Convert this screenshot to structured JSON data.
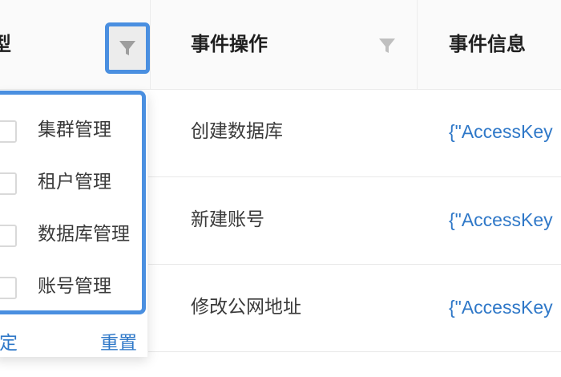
{
  "table": {
    "headers": {
      "type_partial": "型",
      "operation": "事件操作",
      "info": "事件信息"
    },
    "rows": [
      {
        "operation": "创建数据库",
        "info": "{\"AccessKey"
      },
      {
        "operation": "新建账号",
        "info": "{\"AccessKey"
      },
      {
        "operation": "修改公网地址",
        "info": "{\"AccessKey"
      }
    ]
  },
  "filter_dropdown": {
    "options": [
      {
        "label": "集群管理",
        "checked": false
      },
      {
        "label": "租户管理",
        "checked": false
      },
      {
        "label": "数据库管理",
        "checked": false
      },
      {
        "label": "账号管理",
        "checked": false
      }
    ],
    "confirm_label": "确定",
    "confirm_visible_fragment": "确定",
    "reset_label": "重置"
  },
  "icons": {
    "type_filter": "filter-funnel-icon",
    "operation_filter": "filter-funnel-icon"
  },
  "colors": {
    "highlight": "#4a8fe0",
    "link": "#2f78c8",
    "header_bg": "#fafafa",
    "icon": "#9e9e9e",
    "icon_light": "#bfbfbf"
  }
}
